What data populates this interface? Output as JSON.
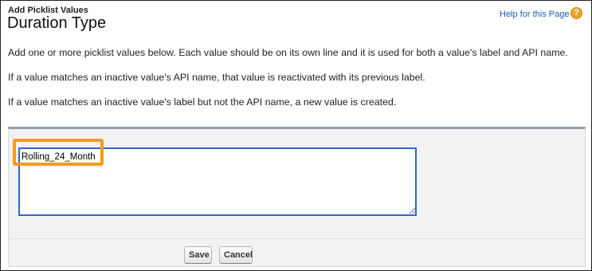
{
  "header": {
    "subtitle": "Add Picklist Values",
    "title": "Duration Type",
    "help_link": "Help for this Page",
    "help_icon": "?"
  },
  "instructions": [
    "Add one or more picklist values below. Each value should be on its own line and it is used for both a value's label and API name.",
    "If a value matches an inactive value's API name, that value is reactivated with its previous label.",
    "If a value matches an inactive value's label but not the API name, a new value is created."
  ],
  "form": {
    "textarea_value": "Rolling_24_Month",
    "save_label": "Save",
    "cancel_label": "Cancel"
  },
  "colors": {
    "accent": "#f59b1c",
    "focus": "#2b6cc4",
    "link": "#1a5eb0",
    "help_icon": "#e8a32c"
  }
}
